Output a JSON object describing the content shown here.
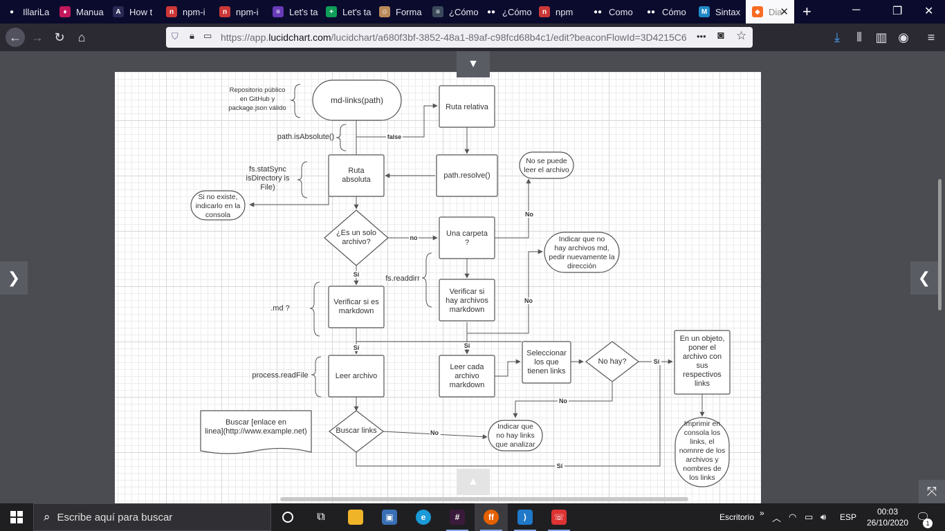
{
  "browser": {
    "tabs": [
      {
        "label": "IllariLa",
        "icon": "github-icon",
        "color": "#0b0b2e",
        "glyph": "●"
      },
      {
        "label": "Manua",
        "icon": "dress-icon",
        "color": "#c2185b",
        "glyph": "♦"
      },
      {
        "label": "How t",
        "icon": "a-logo-icon",
        "color": "#2a2a55",
        "glyph": "A"
      },
      {
        "label": "npm-i",
        "icon": "npm-icon",
        "color": "#cb3837",
        "glyph": "n"
      },
      {
        "label": "npm-i",
        "icon": "npm-icon",
        "color": "#cb3837",
        "glyph": "n"
      },
      {
        "label": "Let's ta",
        "icon": "forms-icon",
        "color": "#673ab7",
        "glyph": "≡"
      },
      {
        "label": "Let's ta",
        "icon": "sheets-icon",
        "color": "#0f9d58",
        "glyph": "+"
      },
      {
        "label": "Forma",
        "icon": "avatar-icon",
        "color": "#b98a5a",
        "glyph": "☺"
      },
      {
        "label": "¿Cómo",
        "icon": "doc-icon",
        "color": "#3a4a5a",
        "glyph": "≡"
      },
      {
        "label": "¿Cómo",
        "icon": "medium-icon",
        "color": "#0b0b2e",
        "glyph": "●●"
      },
      {
        "label": "npm",
        "icon": "npm-icon",
        "color": "#cb3837",
        "glyph": "n"
      },
      {
        "label": "Como",
        "icon": "medium-icon",
        "color": "#0b0b2e",
        "glyph": "●●"
      },
      {
        "label": "Cómo",
        "icon": "medium-icon",
        "color": "#0b0b2e",
        "glyph": "●●"
      },
      {
        "label": "Sintax",
        "icon": "m-logo-icon",
        "color": "#1e88c6",
        "glyph": "M"
      },
      {
        "label": "Dia",
        "icon": "lucidchart-icon",
        "color": "#f96b22",
        "glyph": "◆",
        "active": true
      }
    ],
    "new_tab": "+",
    "url_prefix": "https://app.",
    "url_domain": "lucidchart.com",
    "url_rest": "/lucidchart/a680f3bf-3852-48a1-89af-c98fcd68b4c1/edit?beaconFlowId=3D4215C6",
    "url_more": "•••",
    "nav": {
      "back": "←",
      "forward": "→",
      "reload": "↻",
      "home": "⌂"
    }
  },
  "diagram": {
    "start": "md-links(path)",
    "repo_note": [
      "Repositorio público",
      "en GitHub y",
      "package.json válido"
    ],
    "ruta_relativa": "Ruta relativa",
    "path_is_absolute": "path.isAbsolute()",
    "false_label": "false",
    "path_resolve": "path.resolve()",
    "ruta_absoluta": [
      "Ruta",
      "absoluta"
    ],
    "fs_statsync": [
      "fs.statSync",
      "isDirectory is",
      "File)"
    ],
    "no_existe": [
      "Si no existe,",
      "indicarlo en la",
      "consola"
    ],
    "no_se_puede": [
      "No se puede",
      "leer el archivo"
    ],
    "es_solo_archivo": [
      "¿Es un solo",
      "archivo?"
    ],
    "una_carpeta": [
      "Una  carpeta",
      "?"
    ],
    "no_hay_md": [
      "Indicar que no",
      "hay archivos md,",
      "pedir nuevamente la",
      "dirección"
    ],
    "fs_readdir": "fs.readdirr",
    "md_q": ".md ?",
    "verificar_md": [
      "Verificar si es",
      "markdown"
    ],
    "verificar_hay": [
      "Verificar si",
      "hay archivos",
      "markdown"
    ],
    "process_readfile": "process.readFile",
    "leer_archivo": "Leer archivo",
    "leer_cada": [
      "Leer cada",
      "archivo",
      "markdown"
    ],
    "seleccionar": [
      "Seleccionar",
      "los que",
      "tienen links"
    ],
    "no_hay": "No hay?",
    "objeto": [
      "En un objeto,",
      "poner el",
      "archivo con",
      "sus",
      "respectivos",
      "links"
    ],
    "buscar_doc": [
      "Buscar [enlace en",
      "linea](http://www.example.net)"
    ],
    "buscar_links": "Buscar links",
    "no_hay_links": [
      "Indicar que",
      "no hay links",
      "que analizar"
    ],
    "imprimir": [
      "Imprimir en",
      "consola los",
      "links, el",
      "nomnre de los",
      "archivos y",
      "nombres de",
      "los links"
    ],
    "lbl_no": "no",
    "lbl_No": "No",
    "lbl_si": "Sí"
  },
  "taskbar": {
    "search_placeholder": "Escribe aquí para buscar",
    "desktop_label": "Escritorio",
    "chevron": "»",
    "lang": "ESP",
    "time": "00:03",
    "date": "26/10/2020",
    "notif_count": "1"
  }
}
